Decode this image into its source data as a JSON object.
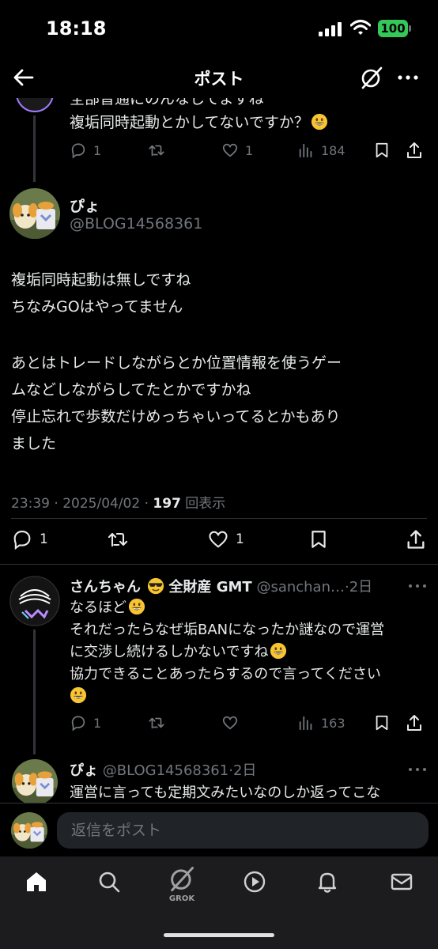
{
  "status_bar": {
    "time": "18:18",
    "battery": "100"
  },
  "header": {
    "title": "ポスト"
  },
  "prev_reply": {
    "partial_line": "全部普通にのんなしてますね",
    "text": "複垢同時起動とかしてないですか？",
    "replies": "1",
    "reposts": "",
    "likes": "1",
    "views": "184"
  },
  "main_post": {
    "display_name": "ぴょ",
    "handle": "@BLOG14568361",
    "lines": [
      "複垢同時起動は無しですね",
      "ちなみGOはやってません",
      "",
      "あとはトレードしながらとか位置情報を使うゲー",
      "ムなどしながらしてたとかですかね",
      "停止忘れで歩数だけめっちゃいってるとかもあり",
      "ました"
    ],
    "meta_time": "23:39 · 2025/04/02 · ",
    "meta_views": "197",
    "meta_views_label": " 回表示",
    "replies": "1",
    "reposts": "",
    "likes": "1"
  },
  "reply_sanchan": {
    "display_name": "さんちゃん",
    "name_suffix": "全財産 GMT",
    "handle": "@sanchan…",
    "time": "2日",
    "lines": [
      "なるほど",
      "それだったらなぜ垢BANになったか謎なので運営",
      "に交渉し続けるしかないですね",
      "協力できることあったらするので言ってください",
      ""
    ],
    "replies": "1",
    "reposts": "",
    "likes": "",
    "views": "163"
  },
  "reply_pyo": {
    "display_name": "ぴょ",
    "handle": "@BLOG14568361",
    "time": "2日",
    "text": "運営に言っても定期文みたいなのしか返ってこな"
  },
  "reply_bar": {
    "placeholder": "返信をポスト"
  },
  "bottom_nav": {
    "grok_label": "GROK"
  },
  "colors": {
    "background": "#000000",
    "text": "#e7e9ea",
    "secondary": "#71767b",
    "divider": "#2f3336",
    "battery": "#34c759"
  }
}
